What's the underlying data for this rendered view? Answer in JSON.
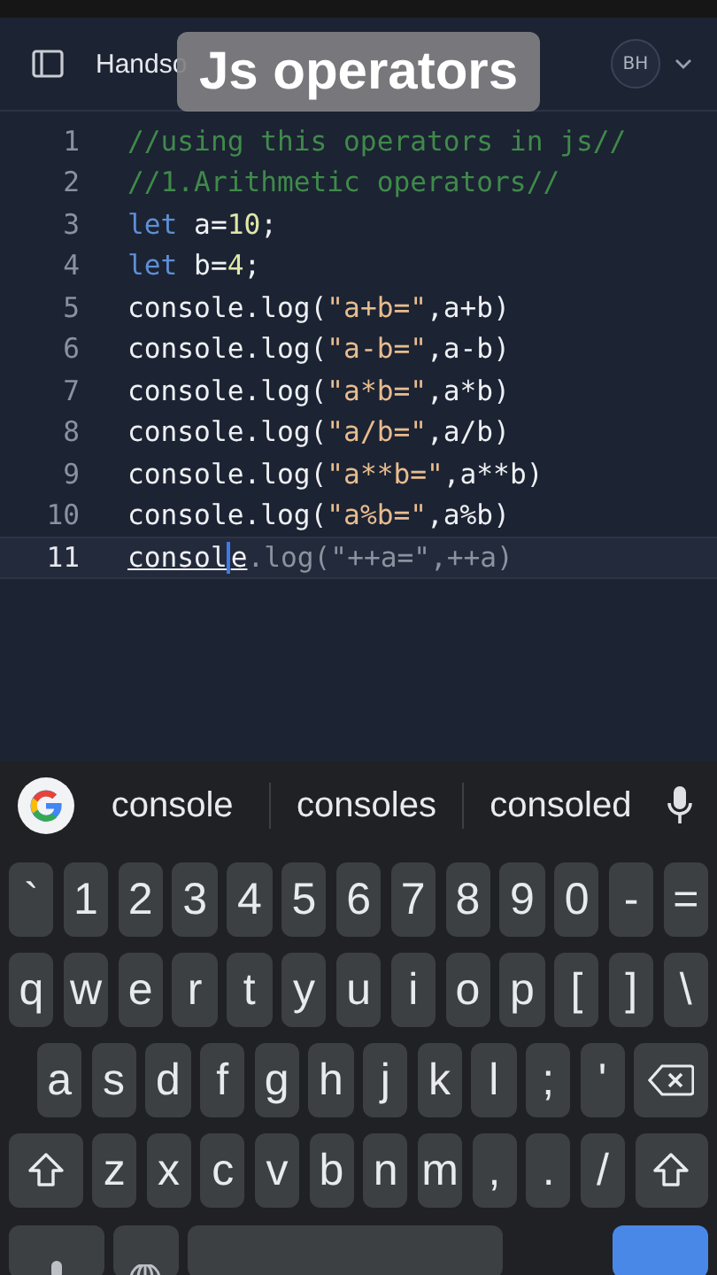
{
  "header": {
    "project": "Handso",
    "avatar": "BH"
  },
  "overlay_caption": "Js operators",
  "editor": {
    "lines": [
      {
        "number": "1",
        "current": false,
        "tokens": [
          {
            "text": "//using this operators in js//",
            "kind": "comment"
          }
        ]
      },
      {
        "number": "2",
        "current": false,
        "tokens": [
          {
            "text": "//1.Arithmetic operators//",
            "kind": "comment"
          }
        ]
      },
      {
        "number": "3",
        "current": false,
        "tokens": [
          {
            "text": "let",
            "kind": "keyword"
          },
          {
            "text": " a=",
            "kind": "plain"
          },
          {
            "text": "10",
            "kind": "number"
          },
          {
            "text": ";",
            "kind": "plain"
          }
        ]
      },
      {
        "number": "4",
        "current": false,
        "tokens": [
          {
            "text": "let",
            "kind": "keyword"
          },
          {
            "text": " b=",
            "kind": "plain"
          },
          {
            "text": "4",
            "kind": "number"
          },
          {
            "text": ";",
            "kind": "plain"
          }
        ]
      },
      {
        "number": "5",
        "current": false,
        "tokens": [
          {
            "text": "console.log(",
            "kind": "plain"
          },
          {
            "text": "\"a+b=\"",
            "kind": "string"
          },
          {
            "text": ",a+b)",
            "kind": "plain"
          }
        ]
      },
      {
        "number": "6",
        "current": false,
        "tokens": [
          {
            "text": "console.log(",
            "kind": "plain"
          },
          {
            "text": "\"a-b=\"",
            "kind": "string"
          },
          {
            "text": ",a-b)",
            "kind": "plain"
          }
        ]
      },
      {
        "number": "7",
        "current": false,
        "tokens": [
          {
            "text": "console.log(",
            "kind": "plain"
          },
          {
            "text": "\"a*b=\"",
            "kind": "string"
          },
          {
            "text": ",a*b)",
            "kind": "plain"
          }
        ]
      },
      {
        "number": "8",
        "current": false,
        "tokens": [
          {
            "text": "console.log(",
            "kind": "plain"
          },
          {
            "text": "\"a/b=\"",
            "kind": "string"
          },
          {
            "text": ",a/b)",
            "kind": "plain"
          }
        ]
      },
      {
        "number": "9",
        "current": false,
        "tokens": [
          {
            "text": "console.log(",
            "kind": "plain"
          },
          {
            "text": "\"a**b=\"",
            "kind": "string"
          },
          {
            "text": ",a**b)",
            "kind": "plain"
          }
        ]
      },
      {
        "number": "10",
        "current": false,
        "tokens": [
          {
            "text": "console.log(",
            "kind": "plain"
          },
          {
            "text": "\"a%b=\"",
            "kind": "string"
          },
          {
            "text": ",a%b)",
            "kind": "plain"
          }
        ]
      },
      {
        "number": "11",
        "current": true,
        "tokens": [
          {
            "text": "consol",
            "kind": "typed"
          },
          {
            "text": "e",
            "kind": "typed-cursor"
          },
          {
            "text": ".log(\"++a=\",++a)",
            "kind": "dim"
          }
        ]
      }
    ]
  },
  "keyboard": {
    "suggestions": [
      "console",
      "consoles",
      "consoled"
    ],
    "rows": [
      [
        {
          "kind": "char",
          "label": "`"
        },
        {
          "kind": "char",
          "label": "1"
        },
        {
          "kind": "char",
          "label": "2"
        },
        {
          "kind": "char",
          "label": "3"
        },
        {
          "kind": "char",
          "label": "4"
        },
        {
          "kind": "char",
          "label": "5"
        },
        {
          "kind": "char",
          "label": "6"
        },
        {
          "kind": "char",
          "label": "7"
        },
        {
          "kind": "char",
          "label": "8"
        },
        {
          "kind": "char",
          "label": "9"
        },
        {
          "kind": "char",
          "label": "0"
        },
        {
          "kind": "char",
          "label": "-"
        },
        {
          "kind": "char",
          "label": "="
        }
      ],
      [
        {
          "kind": "char",
          "label": "q"
        },
        {
          "kind": "char",
          "label": "w"
        },
        {
          "kind": "char",
          "label": "e"
        },
        {
          "kind": "char",
          "label": "r"
        },
        {
          "kind": "char",
          "label": "t"
        },
        {
          "kind": "char",
          "label": "y"
        },
        {
          "kind": "char",
          "label": "u"
        },
        {
          "kind": "char",
          "label": "i"
        },
        {
          "kind": "char",
          "label": "o"
        },
        {
          "kind": "char",
          "label": "p"
        },
        {
          "kind": "char",
          "label": "["
        },
        {
          "kind": "char",
          "label": "]"
        },
        {
          "kind": "char",
          "label": "\\"
        }
      ],
      [
        {
          "kind": "char",
          "label": "a"
        },
        {
          "kind": "char",
          "label": "s"
        },
        {
          "kind": "char",
          "label": "d"
        },
        {
          "kind": "char",
          "label": "f"
        },
        {
          "kind": "char",
          "label": "g"
        },
        {
          "kind": "char",
          "label": "h"
        },
        {
          "kind": "char",
          "label": "j"
        },
        {
          "kind": "char",
          "label": "k"
        },
        {
          "kind": "char",
          "label": "l"
        },
        {
          "kind": "char",
          "label": ";"
        },
        {
          "kind": "char",
          "label": "'"
        },
        {
          "kind": "backspace"
        }
      ],
      [
        {
          "kind": "shift"
        },
        {
          "kind": "char",
          "label": "z"
        },
        {
          "kind": "char",
          "label": "x"
        },
        {
          "kind": "char",
          "label": "c"
        },
        {
          "kind": "char",
          "label": "v"
        },
        {
          "kind": "char",
          "label": "b"
        },
        {
          "kind": "char",
          "label": "n"
        },
        {
          "kind": "char",
          "label": "m"
        },
        {
          "kind": "char",
          "label": ","
        },
        {
          "kind": "char",
          "label": "."
        },
        {
          "kind": "char",
          "label": "/"
        },
        {
          "kind": "shift"
        }
      ],
      [
        {
          "kind": "mic"
        },
        {
          "kind": "globe"
        },
        {
          "kind": "space"
        },
        {
          "kind": "gap"
        },
        {
          "kind": "enter"
        }
      ]
    ]
  }
}
